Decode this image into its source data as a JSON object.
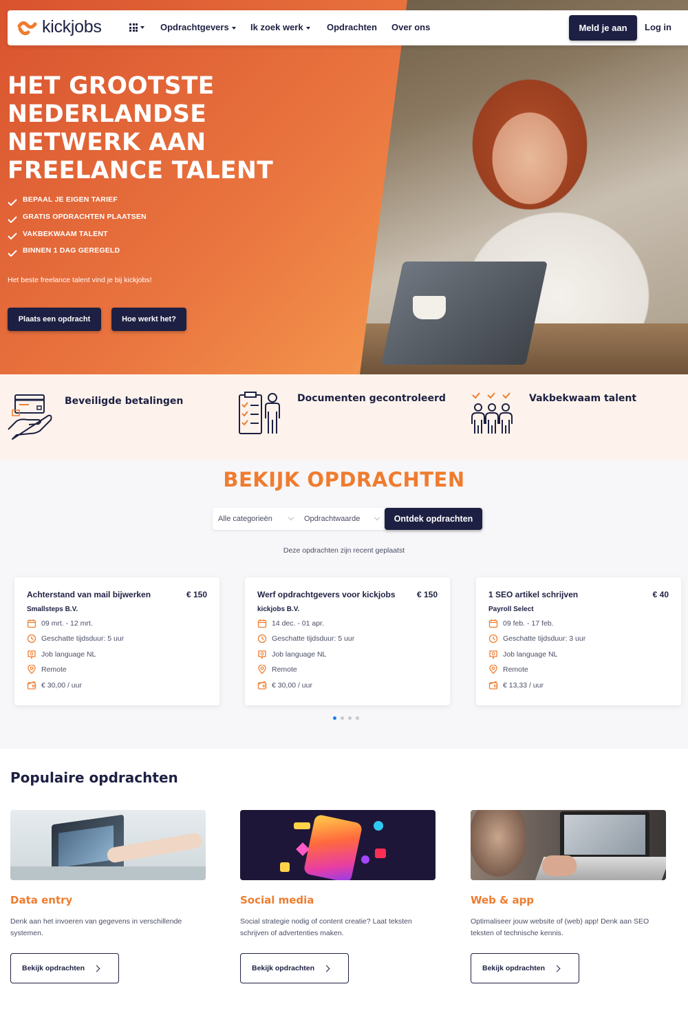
{
  "colors": {
    "navy": "#1d2042",
    "orange": "#ef7c2e",
    "hero_gradient_start": "#d9532e",
    "hero_gradient_end": "#f59a4f",
    "trust_bg": "#fdf3ec",
    "dot_active": "#1a7cf0"
  },
  "nav": {
    "logo_text": "kickjobs",
    "apps_icon": "grid-icon",
    "links": [
      "Opdrachtgevers",
      "Ik zoek werk",
      "Opdrachten",
      "Over ons"
    ],
    "signup_label": "Meld je aan",
    "login_label": "Log in"
  },
  "hero": {
    "title_lines": [
      "HET GROOTSTE",
      "NEDERLANDSE",
      "NETWERK AAN",
      "FREELANCE TALENT"
    ],
    "features": [
      "BEPAAL JE EIGEN TARIEF",
      "GRATIS OPDRACHTEN PLAATSEN",
      "VAKBEKWAAM TALENT",
      "BINNEN 1 DAG GEREGELD"
    ],
    "subtitle": "Het beste freelance talent vind je bij kickjobs!",
    "primary_button": "Plaats een opdracht",
    "secondary_button": "Hoe werkt het?"
  },
  "trust": [
    {
      "icon": "secure-payment-icon",
      "label": "Beveiligde betalingen"
    },
    {
      "icon": "checked-documents-icon",
      "label": "Documenten gecontroleerd"
    },
    {
      "icon": "skilled-team-icon",
      "label": "Vakbekwaam talent"
    }
  ],
  "browse": {
    "title": "BEKIJK OPDRACHTEN",
    "category_select": "Alle categorieën",
    "value_select": "Opdrachtwaarde",
    "search_button": "Ontdek opdrachten",
    "recent_text": "Deze opdrachten zijn recent geplaatst",
    "jobs": [
      {
        "title": "Achterstand van mail bijwerken",
        "price": "€ 150",
        "company": "Smallsteps B.V.",
        "dates": "09 mrt. - 12 mrt.",
        "duration": "Geschatte tijdsduur: 5 uur",
        "language": "Job language NL",
        "location": "Remote",
        "rate": "€ 30,00 / uur"
      },
      {
        "title": "Werf opdrachtgevers voor kickjobs",
        "price": "€ 150",
        "company": "kickjobs B.V.",
        "dates": "14 dec. - 01 apr.",
        "duration": "Geschatte tijdsduur: 5 uur",
        "language": "Job language NL",
        "location": "Remote",
        "rate": "€ 30,00 / uur"
      },
      {
        "title": "1 SEO artikel schrijven",
        "price": "€ 40",
        "company": "Payroll Select",
        "dates": "09 feb. - 17 feb.",
        "duration": "Geschatte tijdsduur: 3 uur",
        "language": "Job language NL",
        "location": "Remote",
        "rate": "€ 13,33 / uur"
      }
    ],
    "carousel_pages": 4,
    "carousel_active": 1
  },
  "popular": {
    "title": "Populaire opdrachten",
    "categories": [
      {
        "name": "Data entry",
        "description": "Denk aan het invoeren van gegevens in verschillende systemen.",
        "button": "Bekijk opdrachten"
      },
      {
        "name": "Social media",
        "description": "Social strategie nodig of content creatie? Laat teksten schrijven of advertenties maken.",
        "button": "Bekijk opdrachten"
      },
      {
        "name": "Web & app",
        "description": "Optimaliseer jouw website of (web) app! Denk aan SEO teksten of technische kennis.",
        "button": "Bekijk opdrachten"
      }
    ]
  }
}
